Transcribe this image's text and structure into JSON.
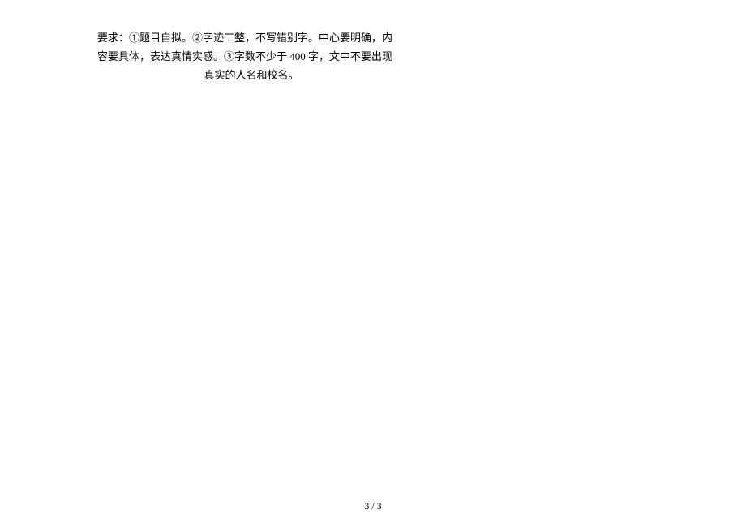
{
  "document": {
    "body_line1": "要求：①题目自拟。②字迹工整，不写错别字。中心要明确，内",
    "body_line2": "容要具体，表达真情实感。③字数不少于 400 字，文中不要出现",
    "body_line3": "真实的人名和校名。",
    "page_number": "3 / 3"
  }
}
